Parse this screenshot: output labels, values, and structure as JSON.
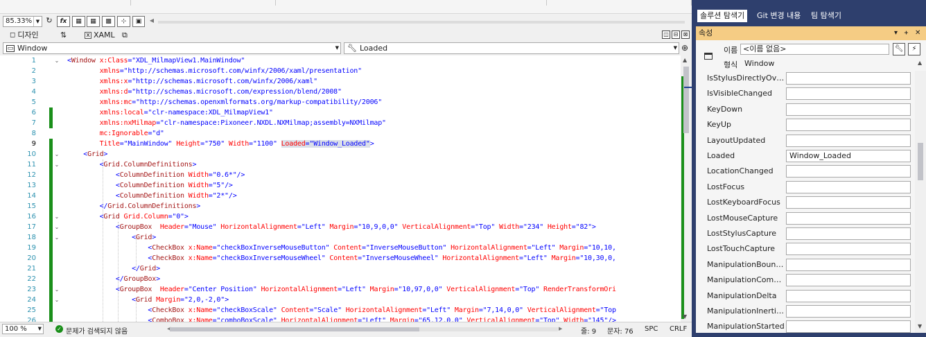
{
  "toolbar": {
    "zoom": "85.33%",
    "fx_label": "fx"
  },
  "tabs": {
    "design": "디자인",
    "swap": "⇅",
    "xaml": "XAML"
  },
  "nav": {
    "element": "Window",
    "event": "Loaded"
  },
  "code_lines": [
    {
      "n": "1",
      "html": "<span class='b'>&lt;</span><span class='t'>Window</span> <span class='a'>x:Class</span><span class='b'>=</span><span class='v'>\"XDL_MilmapView1.MainWindow\"</span>"
    },
    {
      "n": "2",
      "html": "        <span class='a'>xmlns</span><span class='b'>=</span><span class='v'>\"http://schemas.microsoft.com/winfx/2006/xaml/presentation\"</span>"
    },
    {
      "n": "3",
      "html": "        <span class='a'>xmlns:x</span><span class='b'>=</span><span class='v'>\"http://schemas.microsoft.com/winfx/2006/xaml\"</span>"
    },
    {
      "n": "4",
      "html": "        <span class='a'>xmlns:d</span><span class='b'>=</span><span class='v'>\"http://schemas.microsoft.com/expression/blend/2008\"</span>"
    },
    {
      "n": "5",
      "html": "        <span class='a'>xmlns:mc</span><span class='b'>=</span><span class='v'>\"http://schemas.openxmlformats.org/markup-compatibility/2006\"</span>"
    },
    {
      "n": "6",
      "html": "        <span class='a'>xmlns:local</span><span class='b'>=</span><span class='v'>\"clr-namespace:XDL_MilmapView1\"</span>"
    },
    {
      "n": "7",
      "html": "        <span class='a'>xmlns:nxMilmap</span><span class='b'>=</span><span class='v'>\"clr-namespace:Pixoneer.NXDL.NXMilmap;assembly=NXMilmap\"</span>"
    },
    {
      "n": "8",
      "html": "        <span class='a'>mc:Ignorable</span><span class='b'>=</span><span class='v'>\"d\"</span>"
    },
    {
      "n": "9",
      "html": "        <span class='a'>Title</span><span class='b'>=</span><span class='v'>\"MainWindow\"</span> <span class='a'>Height</span><span class='b'>=</span><span class='v'>\"750\"</span> <span class='a'>Width</span><span class='b'>=</span><span class='v'>\"1100\"</span> <span class='hl'><span class='a'>Loaded</span><span class='b'>=</span><span class='v'>\"Window_Loaded\"</span></span><span class='b'>&gt;</span>"
    },
    {
      "n": "10",
      "html": "    <span class='b'>&lt;</span><span class='t'>Grid</span><span class='b'>&gt;</span>"
    },
    {
      "n": "11",
      "html": "        <span class='b'>&lt;</span><span class='t'>Grid.ColumnDefinitions</span><span class='b'>&gt;</span>"
    },
    {
      "n": "12",
      "html": "            <span class='b'>&lt;</span><span class='t'>ColumnDefinition</span> <span class='a'>Width</span><span class='b'>=</span><span class='v'>\"0.6*\"</span><span class='b'>/&gt;</span>"
    },
    {
      "n": "13",
      "html": "            <span class='b'>&lt;</span><span class='t'>ColumnDefinition</span> <span class='a'>Width</span><span class='b'>=</span><span class='v'>\"5\"</span><span class='b'>/&gt;</span>"
    },
    {
      "n": "14",
      "html": "            <span class='b'>&lt;</span><span class='t'>ColumnDefinition</span> <span class='a'>Width</span><span class='b'>=</span><span class='v'>\"2*\"</span><span class='b'>/&gt;</span>"
    },
    {
      "n": "15",
      "html": "        <span class='b'>&lt;/</span><span class='t'>Grid.ColumnDefinitions</span><span class='b'>&gt;</span>"
    },
    {
      "n": "16",
      "html": "        <span class='b'>&lt;</span><span class='t'>Grid</span> <span class='a'>Grid.Column</span><span class='b'>=</span><span class='v'>\"0\"</span><span class='b'>&gt;</span>"
    },
    {
      "n": "17",
      "html": "            <span class='b'>&lt;</span><span class='t'>GroupBox</span>  <span class='a'>Header</span><span class='b'>=</span><span class='v'>\"Mouse\"</span> <span class='a'>HorizontalAlignment</span><span class='b'>=</span><span class='v'>\"Left\"</span> <span class='a'>Margin</span><span class='b'>=</span><span class='v'>\"10,9,0,0\"</span> <span class='a'>VerticalAlignment</span><span class='b'>=</span><span class='v'>\"Top\"</span> <span class='a'>Width</span><span class='b'>=</span><span class='v'>\"234\"</span> <span class='a'>Height</span><span class='b'>=</span><span class='v'>\"82\"</span><span class='b'>&gt;</span>"
    },
    {
      "n": "18",
      "html": "                <span class='b'>&lt;</span><span class='t'>Grid</span><span class='b'>&gt;</span>"
    },
    {
      "n": "19",
      "html": "                    <span class='b'>&lt;</span><span class='t'>CheckBox</span> <span class='a'>x:Name</span><span class='b'>=</span><span class='v'>\"checkBoxInverseMouseButton\"</span> <span class='a'>Content</span><span class='b'>=</span><span class='v'>\"InverseMouseButton\"</span> <span class='a'>HorizontalAlignment</span><span class='b'>=</span><span class='v'>\"Left\"</span> <span class='a'>Margin</span><span class='b'>=</span><span class='v'>\"10,10,</span>"
    },
    {
      "n": "20",
      "html": "                    <span class='b'>&lt;</span><span class='t'>CheckBox</span> <span class='a'>x:Name</span><span class='b'>=</span><span class='v'>\"checkBoxInverseMouseWheel\"</span> <span class='a'>Content</span><span class='b'>=</span><span class='v'>\"InverseMouseWheel\"</span> <span class='a'>HorizontalAlignment</span><span class='b'>=</span><span class='v'>\"Left\"</span> <span class='a'>Margin</span><span class='b'>=</span><span class='v'>\"10,30,0,</span>"
    },
    {
      "n": "21",
      "html": "                <span class='b'>&lt;/</span><span class='t'>Grid</span><span class='b'>&gt;</span>"
    },
    {
      "n": "22",
      "html": "            <span class='b'>&lt;/</span><span class='t'>GroupBox</span><span class='b'>&gt;</span>"
    },
    {
      "n": "23",
      "html": "            <span class='b'>&lt;</span><span class='t'>GroupBox</span>  <span class='a'>Header</span><span class='b'>=</span><span class='v'>\"Center Position\"</span> <span class='a'>HorizontalAlignment</span><span class='b'>=</span><span class='v'>\"Left\"</span> <span class='a'>Margin</span><span class='b'>=</span><span class='v'>\"10,97,0,0\"</span> <span class='a'>VerticalAlignment</span><span class='b'>=</span><span class='v'>\"Top\"</span> <span class='a'>RenderTransformOri</span>"
    },
    {
      "n": "24",
      "html": "                <span class='b'>&lt;</span><span class='t'>Grid</span> <span class='a'>Margin</span><span class='b'>=</span><span class='v'>\"2,0,-2,0\"</span><span class='b'>&gt;</span>"
    },
    {
      "n": "25",
      "html": "                    <span class='b'>&lt;</span><span class='t'>CheckBox</span> <span class='a'>x:Name</span><span class='b'>=</span><span class='v'>\"checkBoxScale\"</span> <span class='a'>Content</span><span class='b'>=</span><span class='v'>\"Scale\"</span> <span class='a'>HorizontalAlignment</span><span class='b'>=</span><span class='v'>\"Left\"</span> <span class='a'>Margin</span><span class='b'>=</span><span class='v'>\"7,14,0,0\"</span> <span class='a'>VerticalAlignment</span><span class='b'>=</span><span class='v'>\"Top</span>"
    },
    {
      "n": "26",
      "html": "                    <span class='b'>&lt;</span><span class='t'>ComboBox</span> <span class='a'>x:Name</span><span class='b'>=</span><span class='v'>\"comboBoxScale\"</span> <span class='a'>HorizontalAlignment</span><span class='b'>=</span><span class='v'>\"Left\"</span> <span class='a'>Margin</span><span class='b'>=</span><span class='v'>\"65,12,0,0\"</span> <span class='a'>VerticalAlignment</span><span class='b'>=</span><span class='v'>\"Top\"</span> <span class='a'>Width</span><span class='b'>=</span><span class='v'>\"145\"</span><span class='b'>/&gt;</span>"
    }
  ],
  "status": {
    "zoom": "100 %",
    "message": "문제가 검색되지 않음",
    "line": "줄: 9",
    "char": "문자: 76",
    "spc": "SPC",
    "crlf": "CRLF"
  },
  "solution_tabs": [
    "솔루션 탐색기",
    "Git 변경 내용",
    "팀 탐색기"
  ],
  "properties": {
    "title": "속성",
    "name_label": "이름",
    "name_value": "<이름 없음>",
    "type_label": "형식",
    "type_value": "Window",
    "events": [
      {
        "name": "IsStylusDirectlyOver...",
        "value": ""
      },
      {
        "name": "IsVisibleChanged",
        "value": ""
      },
      {
        "name": "KeyDown",
        "value": ""
      },
      {
        "name": "KeyUp",
        "value": ""
      },
      {
        "name": "LayoutUpdated",
        "value": ""
      },
      {
        "name": "Loaded",
        "value": "Window_Loaded"
      },
      {
        "name": "LocationChanged",
        "value": ""
      },
      {
        "name": "LostFocus",
        "value": ""
      },
      {
        "name": "LostKeyboardFocus",
        "value": ""
      },
      {
        "name": "LostMouseCapture",
        "value": ""
      },
      {
        "name": "LostStylusCapture",
        "value": ""
      },
      {
        "name": "LostTouchCapture",
        "value": ""
      },
      {
        "name": "ManipulationBound...",
        "value": ""
      },
      {
        "name": "ManipulationCompl...",
        "value": ""
      },
      {
        "name": "ManipulationDelta",
        "value": ""
      },
      {
        "name": "ManipulationInertia...",
        "value": ""
      },
      {
        "name": "ManipulationStarted",
        "value": ""
      }
    ]
  }
}
